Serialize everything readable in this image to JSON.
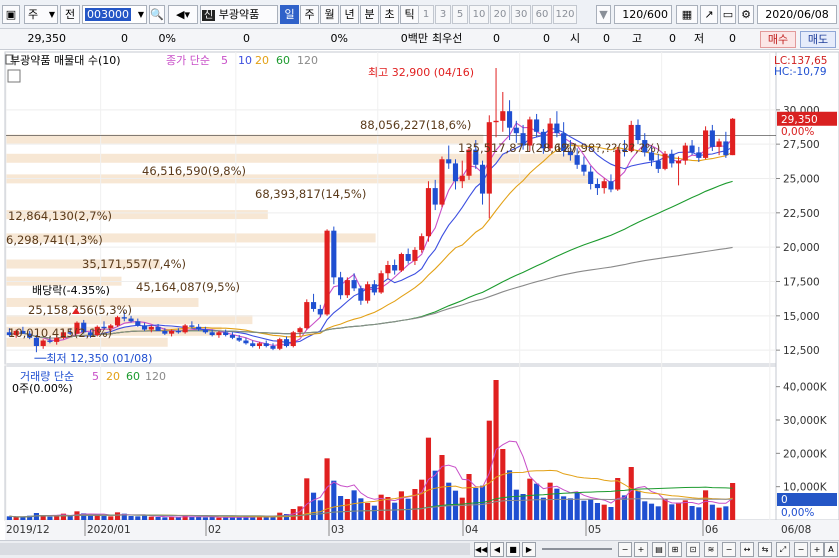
{
  "toolbar": {
    "type_label": "주",
    "market_label": "전",
    "code": "003000",
    "stock_name": "부광약품",
    "periods": [
      "일",
      "주",
      "월",
      "년",
      "분",
      "초",
      "틱"
    ],
    "active_period": "일",
    "numbers": [
      "1",
      "3",
      "5",
      "10",
      "20",
      "30",
      "60",
      "120"
    ],
    "count": "120/600",
    "date": "2020/06/08"
  },
  "info": {
    "price": "29,350",
    "change": "0",
    "change_pct": "0%",
    "volume": "0",
    "volume_pct": "0%",
    "value_label": "0백만",
    "best_label": "최우선",
    "bid": "0",
    "ask": "0",
    "open_label": "시",
    "open": "0",
    "high_label": "고",
    "high": "0",
    "low_label": "저",
    "low": "0",
    "buy_label": "매수",
    "sell_label": "매도"
  },
  "legend": {
    "title": "부광약품 매물대 수(10)",
    "ma_label": "종가 단순",
    "ma_periods": [
      "5",
      "10",
      "20",
      "60",
      "120"
    ],
    "ma_colors": [
      "#c84fc8",
      "#3d4fe0",
      "#e3a116",
      "#1c9b2e",
      "#8a8a8a"
    ],
    "volume_label": "거래량 단순",
    "volume_periods": [
      "5",
      "20",
      "60",
      "120"
    ],
    "volume_info": "0주(0.00%)"
  },
  "annotations": {
    "high": "최고 32,900 (04/16)",
    "low": "최저 12,350 (01/08)",
    "dividend": "배당락(-4.35%)"
  },
  "profile_labels": [
    "10,010,415(2,1%)",
    "25,158,256(5,3%)",
    "45,164,087(9,5%)",
    "35,171,557(7,4%)",
    "6,298,741(1,3%)",
    "12,864,130(2,7%)",
    "68,393,817(14,5%)",
    "46,516,590(9,8%)",
    "135,517,871(28,6%)",
    "88,056,227(18,6%)",
    "127,98?,??(2?,?%)"
  ],
  "right_info": {
    "lc": "LC:137,65",
    "hc": "HC:-10,79",
    "price_tag": "29,350",
    "price_pct": "0,00%",
    "volume_tag": "0",
    "volume_pct": "0,00%"
  },
  "price_ticks": [
    "30,000",
    "27,500",
    "25,000",
    "22,500",
    "20,000",
    "17,500",
    "15,000",
    "12,500"
  ],
  "volume_ticks": [
    "40,000K",
    "30,000K",
    "20,000K",
    "10,000K"
  ],
  "x_labels": [
    "2019/12",
    "2020/01",
    "02",
    "03",
    "04",
    "05",
    "06",
    "06/08"
  ],
  "colors": {
    "up": "#e02020",
    "down": "#1f4fd1",
    "profile": "#f6e4cf"
  },
  "chart_data": {
    "type": "candlestick",
    "stock": "부광약품",
    "period": "일",
    "ylim": [
      11200,
      32900
    ],
    "volume_ylim": [
      0,
      42000
    ],
    "candles": [
      [
        13800,
        14100,
        13500,
        13600
      ],
      [
        13600,
        14000,
        13400,
        13900
      ],
      [
        13900,
        14200,
        13700,
        13700
      ],
      [
        13700,
        13900,
        13300,
        13400
      ],
      [
        13400,
        13600,
        12350,
        12800
      ],
      [
        12800,
        13300,
        12600,
        13200
      ],
      [
        13200,
        13500,
        13000,
        13100
      ],
      [
        13100,
        13500,
        12900,
        13400
      ],
      [
        13400,
        14000,
        13300,
        13800
      ],
      [
        13800,
        14100,
        13600,
        13700
      ],
      [
        13700,
        14600,
        13700,
        14500
      ],
      [
        14500,
        14700,
        13700,
        13800
      ],
      [
        13800,
        14000,
        13400,
        13600
      ],
      [
        13600,
        14300,
        13500,
        14200
      ],
      [
        14200,
        14600,
        14000,
        14100
      ],
      [
        14100,
        14400,
        13900,
        14300
      ],
      [
        14300,
        15000,
        14200,
        14900
      ],
      [
        14900,
        15300,
        14600,
        14800
      ],
      [
        14800,
        15000,
        14500,
        14600
      ],
      [
        14600,
        14800,
        14200,
        14300
      ],
      [
        14300,
        14500,
        13900,
        14000
      ],
      [
        14000,
        14300,
        13800,
        14200
      ],
      [
        14200,
        14400,
        13900,
        13900
      ],
      [
        13900,
        14100,
        13600,
        13700
      ],
      [
        13700,
        14000,
        13500,
        13900
      ],
      [
        13900,
        14100,
        13700,
        13800
      ],
      [
        13800,
        14400,
        13700,
        14300
      ],
      [
        14300,
        14600,
        14100,
        14200
      ],
      [
        14200,
        14400,
        13900,
        14000
      ],
      [
        14000,
        14200,
        13700,
        13800
      ],
      [
        13800,
        14000,
        13500,
        13600
      ],
      [
        13600,
        13900,
        13400,
        13800
      ],
      [
        13800,
        14000,
        13500,
        13600
      ],
      [
        13600,
        13800,
        13300,
        13400
      ],
      [
        13400,
        13600,
        13100,
        13200
      ],
      [
        13200,
        13400,
        12900,
        13000
      ],
      [
        13000,
        13200,
        12700,
        12800
      ],
      [
        12800,
        13100,
        12600,
        13000
      ],
      [
        13000,
        13200,
        12700,
        12800
      ],
      [
        12800,
        13000,
        12500,
        12600
      ],
      [
        12600,
        13400,
        12500,
        13300
      ],
      [
        13300,
        13500,
        12700,
        12800
      ],
      [
        12800,
        13900,
        12700,
        13800
      ],
      [
        13800,
        14200,
        13500,
        14100
      ],
      [
        14100,
        16200,
        14000,
        16000
      ],
      [
        16000,
        16600,
        15300,
        15500
      ],
      [
        15500,
        15800,
        14900,
        15100
      ],
      [
        15100,
        21300,
        15000,
        21200
      ],
      [
        21200,
        21500,
        17300,
        17800
      ],
      [
        17800,
        18200,
        16200,
        16500
      ],
      [
        16500,
        17800,
        16300,
        17600
      ],
      [
        17600,
        18100,
        16800,
        17000
      ],
      [
        17000,
        17200,
        15800,
        16100
      ],
      [
        16100,
        17500,
        15900,
        17300
      ],
      [
        17300,
        17600,
        16500,
        16700
      ],
      [
        16700,
        18300,
        16600,
        18100
      ],
      [
        18100,
        19000,
        17700,
        18700
      ],
      [
        18700,
        19100,
        18000,
        18300
      ],
      [
        18300,
        19600,
        18200,
        19500
      ],
      [
        19500,
        19900,
        18800,
        19000
      ],
      [
        19000,
        20000,
        18700,
        19800
      ],
      [
        19800,
        21000,
        19600,
        20800
      ],
      [
        20800,
        24800,
        20400,
        24300
      ],
      [
        24300,
        24900,
        22700,
        23100
      ],
      [
        23100,
        26600,
        22900,
        26400
      ],
      [
        26400,
        27400,
        25700,
        26100
      ],
      [
        26100,
        26400,
        24200,
        24800
      ],
      [
        24800,
        26300,
        24300,
        25200
      ],
      [
        25200,
        27300,
        24900,
        27100
      ],
      [
        27100,
        27800,
        25700,
        26000
      ],
      [
        26000,
        26300,
        23100,
        23900
      ],
      [
        23900,
        29600,
        22100,
        29100
      ],
      [
        29100,
        32900,
        28000,
        29200
      ],
      [
        29200,
        31300,
        28400,
        29900
      ],
      [
        29900,
        30700,
        27800,
        28700
      ],
      [
        28700,
        29200,
        27600,
        28300
      ],
      [
        28300,
        28900,
        27100,
        27400
      ],
      [
        27400,
        29500,
        27000,
        29300
      ],
      [
        29300,
        29700,
        28000,
        28400
      ],
      [
        28400,
        28600,
        26800,
        27200
      ],
      [
        27200,
        29400,
        27000,
        29000
      ],
      [
        29000,
        29900,
        28000,
        28300
      ],
      [
        28300,
        29100,
        26600,
        27000
      ],
      [
        27000,
        27800,
        26300,
        26700
      ],
      [
        26700,
        27200,
        25700,
        26000
      ],
      [
        26000,
        26600,
        25200,
        25500
      ],
      [
        25500,
        25900,
        24200,
        24600
      ],
      [
        24600,
        25000,
        23800,
        24300
      ],
      [
        24300,
        25000,
        23900,
        24800
      ],
      [
        24800,
        25300,
        24000,
        24200
      ],
      [
        24200,
        27300,
        24100,
        27100
      ],
      [
        27100,
        27800,
        26600,
        27000
      ],
      [
        27000,
        29200,
        26900,
        28900
      ],
      [
        28900,
        29300,
        27500,
        27800
      ],
      [
        27800,
        28300,
        26600,
        26900
      ],
      [
        26900,
        27400,
        25900,
        26300
      ],
      [
        26300,
        26800,
        25400,
        25700
      ],
      [
        25700,
        27000,
        25600,
        26800
      ],
      [
        26800,
        27100,
        25800,
        26100
      ],
      [
        26100,
        26600,
        24500,
        26300
      ],
      [
        26300,
        27600,
        26000,
        27400
      ],
      [
        27400,
        27800,
        26700,
        26900
      ],
      [
        26900,
        27300,
        26200,
        26500
      ],
      [
        26500,
        28800,
        26400,
        28500
      ],
      [
        28500,
        28900,
        27000,
        27300
      ],
      [
        27300,
        27900,
        26700,
        27700
      ],
      [
        27700,
        28400,
        26500,
        26700
      ],
      [
        26700,
        29400,
        26700,
        29350
      ]
    ],
    "volume": [
      1100,
      900,
      800,
      1300,
      2100,
      1500,
      1000,
      1100,
      1900,
      1200,
      2600,
      2000,
      1300,
      1800,
      1200,
      1100,
      2300,
      1900,
      1200,
      1100,
      1300,
      1000,
      900,
      800,
      900,
      800,
      1400,
      1000,
      900,
      800,
      900,
      700,
      800,
      900,
      800,
      1000,
      900,
      1100,
      900,
      1000,
      2200,
      1800,
      3300,
      4100,
      12500,
      8200,
      5900,
      18500,
      11800,
      7200,
      6300,
      8900,
      6500,
      5100,
      4300,
      7600,
      6900,
      5200,
      8600,
      6400,
      9300,
      12100,
      24700,
      14800,
      19500,
      11200,
      8800,
      6700,
      13800,
      9600,
      10300,
      29800,
      42000,
      21300,
      14900,
      9100,
      7800,
      12400,
      10900,
      6700,
      11200,
      9400,
      7100,
      6500,
      8300,
      5800,
      6100,
      5100,
      4600,
      3900,
      12600,
      7400,
      15900,
      8800,
      5600,
      4900,
      4100,
      6300,
      4700,
      5200,
      5900,
      4200,
      3800,
      8900,
      4600,
      3700,
      4100,
      11100
    ],
    "overlay": {
      "lc": 137.65,
      "hc": -10.79
    }
  }
}
